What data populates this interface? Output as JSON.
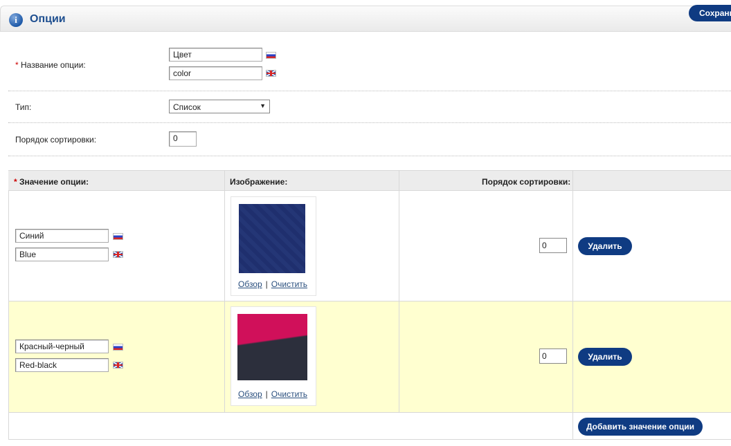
{
  "header": {
    "title": "Опции",
    "save_label": "Сохранить"
  },
  "form": {
    "name_label": "Название опции:",
    "required_mark": "*",
    "name_ru": "Цвет",
    "name_en": "color",
    "type_label": "Тип:",
    "type_value": "Список",
    "sort_label": "Порядок сортировки:",
    "sort_value": "0"
  },
  "values_table": {
    "col_value": "Значение опции:",
    "col_image": "Изображение:",
    "col_sort": "Порядок сортировки:",
    "browse_label": "Обзор",
    "link_sep": "|",
    "clear_label": "Очистить",
    "delete_label": "Удалить",
    "add_label": "Добавить значение опции",
    "rows": [
      {
        "name_ru": "Синий",
        "name_en": "Blue",
        "sort": "0",
        "image_color": "#1f2f6e"
      },
      {
        "name_ru": "Красный-черный",
        "name_en": "Red-black",
        "sort": "0",
        "image_color_top": "#d0105a",
        "image_color_bottom": "#2c2f3c"
      }
    ]
  },
  "colors": {
    "accent": "#0f3b82",
    "highlight_row": "#ffffd0"
  }
}
